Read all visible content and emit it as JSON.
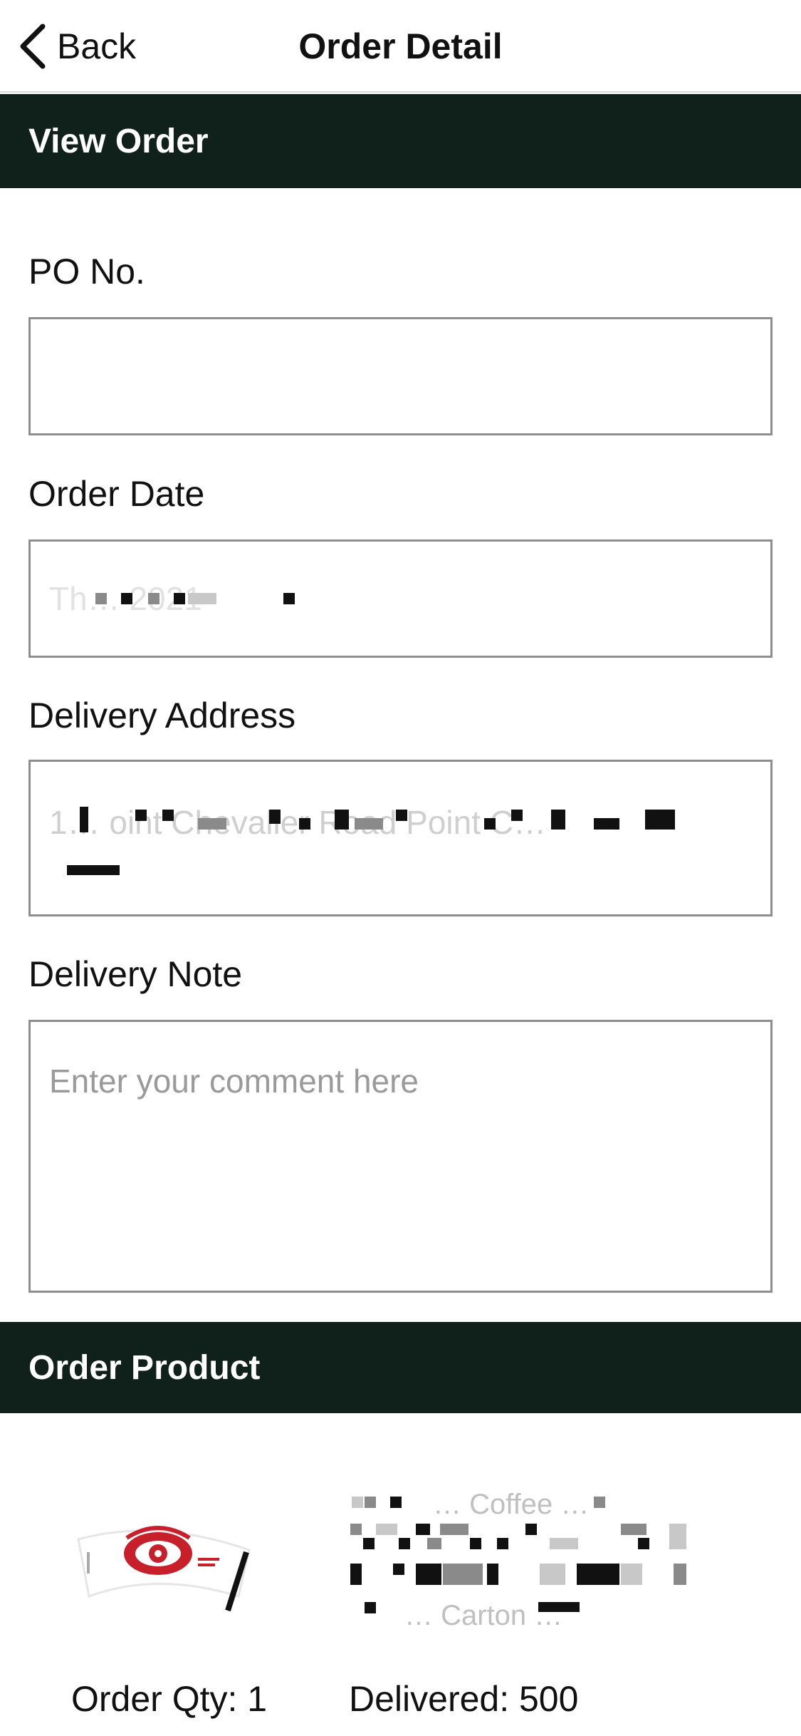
{
  "nav": {
    "back_label": "Back",
    "title": "Order Detail"
  },
  "view_order": {
    "header": "View Order",
    "po_label": "PO No.",
    "po_value": "",
    "order_date_label": "Order Date",
    "order_date_value": "Th… 2021",
    "delivery_address_label": "Delivery Address",
    "delivery_address_value": "1… oint Chevalier Road Point C…",
    "delivery_note_label": "Delivery Note",
    "delivery_note_placeholder": "Enter your comment here",
    "delivery_note_value": ""
  },
  "order_product": {
    "header": "Order Product",
    "products": [
      {
        "name": "… Coffee …",
        "packaging": "… Carton …",
        "image_icon": "coffee-cup-sleeve-eye-logo",
        "order_qty_text": "Order Qty: 1",
        "delivered_text": "Delivered: 500"
      }
    ]
  },
  "colors": {
    "header_bg": "#10201a",
    "header_text": "#ffffff",
    "border": "#8e8e8e",
    "placeholder": "#9a9a9a",
    "logo_red": "#c8202a"
  }
}
